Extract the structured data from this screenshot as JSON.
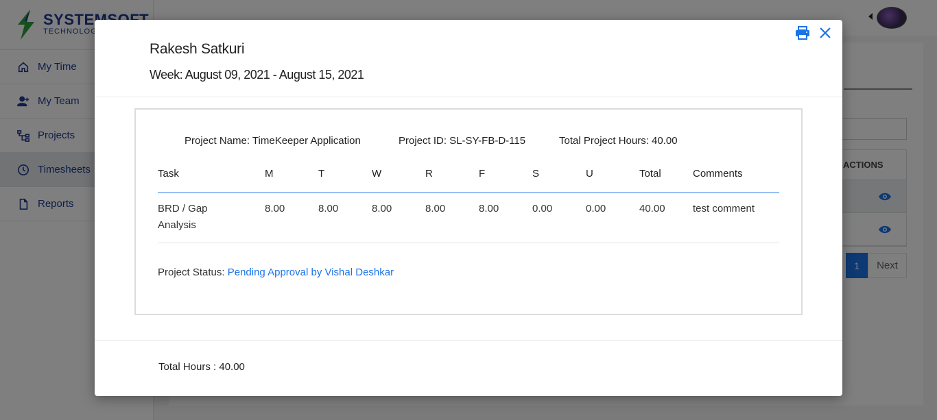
{
  "app": {
    "brand": "SYSTEMSOFT",
    "brand_sub": "TECHNOLOGIES",
    "colors": {
      "primary": "#1a73e8",
      "brand_navy": "#1f3a93",
      "brand_green": "#2e9e3e"
    }
  },
  "sidebar": {
    "items": [
      {
        "label": "My Time",
        "icon": "home-icon"
      },
      {
        "label": "My Team",
        "icon": "add-user-icon"
      },
      {
        "label": "Projects",
        "icon": "hierarchy-icon"
      },
      {
        "label": "Timesheets",
        "icon": "clock-icon",
        "active": true
      },
      {
        "label": "Reports",
        "icon": "document-icon"
      }
    ]
  },
  "background": {
    "table_header": "ACTIONS",
    "pagination": {
      "current_page": "1",
      "next_label": "Next"
    }
  },
  "modal": {
    "employee_name": "Rakesh Satkuri",
    "week": "Week: August 09, 2021 - August 15, 2021",
    "project": {
      "name_text": "Project Name: TimeKeeper Application",
      "id_text": "Project ID: SL-SY-FB-D-115",
      "hours_text": "Total Project Hours: 40.00"
    },
    "columns": [
      "Task",
      "M",
      "T",
      "W",
      "R",
      "F",
      "S",
      "U",
      "Total",
      "Comments"
    ],
    "rows": [
      {
        "task": "BRD / Gap Analysis",
        "m": "8.00",
        "t": "8.00",
        "w": "8.00",
        "r": "8.00",
        "f": "8.00",
        "s": "0.00",
        "u": "0.00",
        "total": "40.00",
        "comments": "test comment"
      }
    ],
    "status_label": "Project Status: ",
    "status_value": "Pending Approval by Vishal Deshkar",
    "total_hours": "Total Hours : 40.00"
  }
}
